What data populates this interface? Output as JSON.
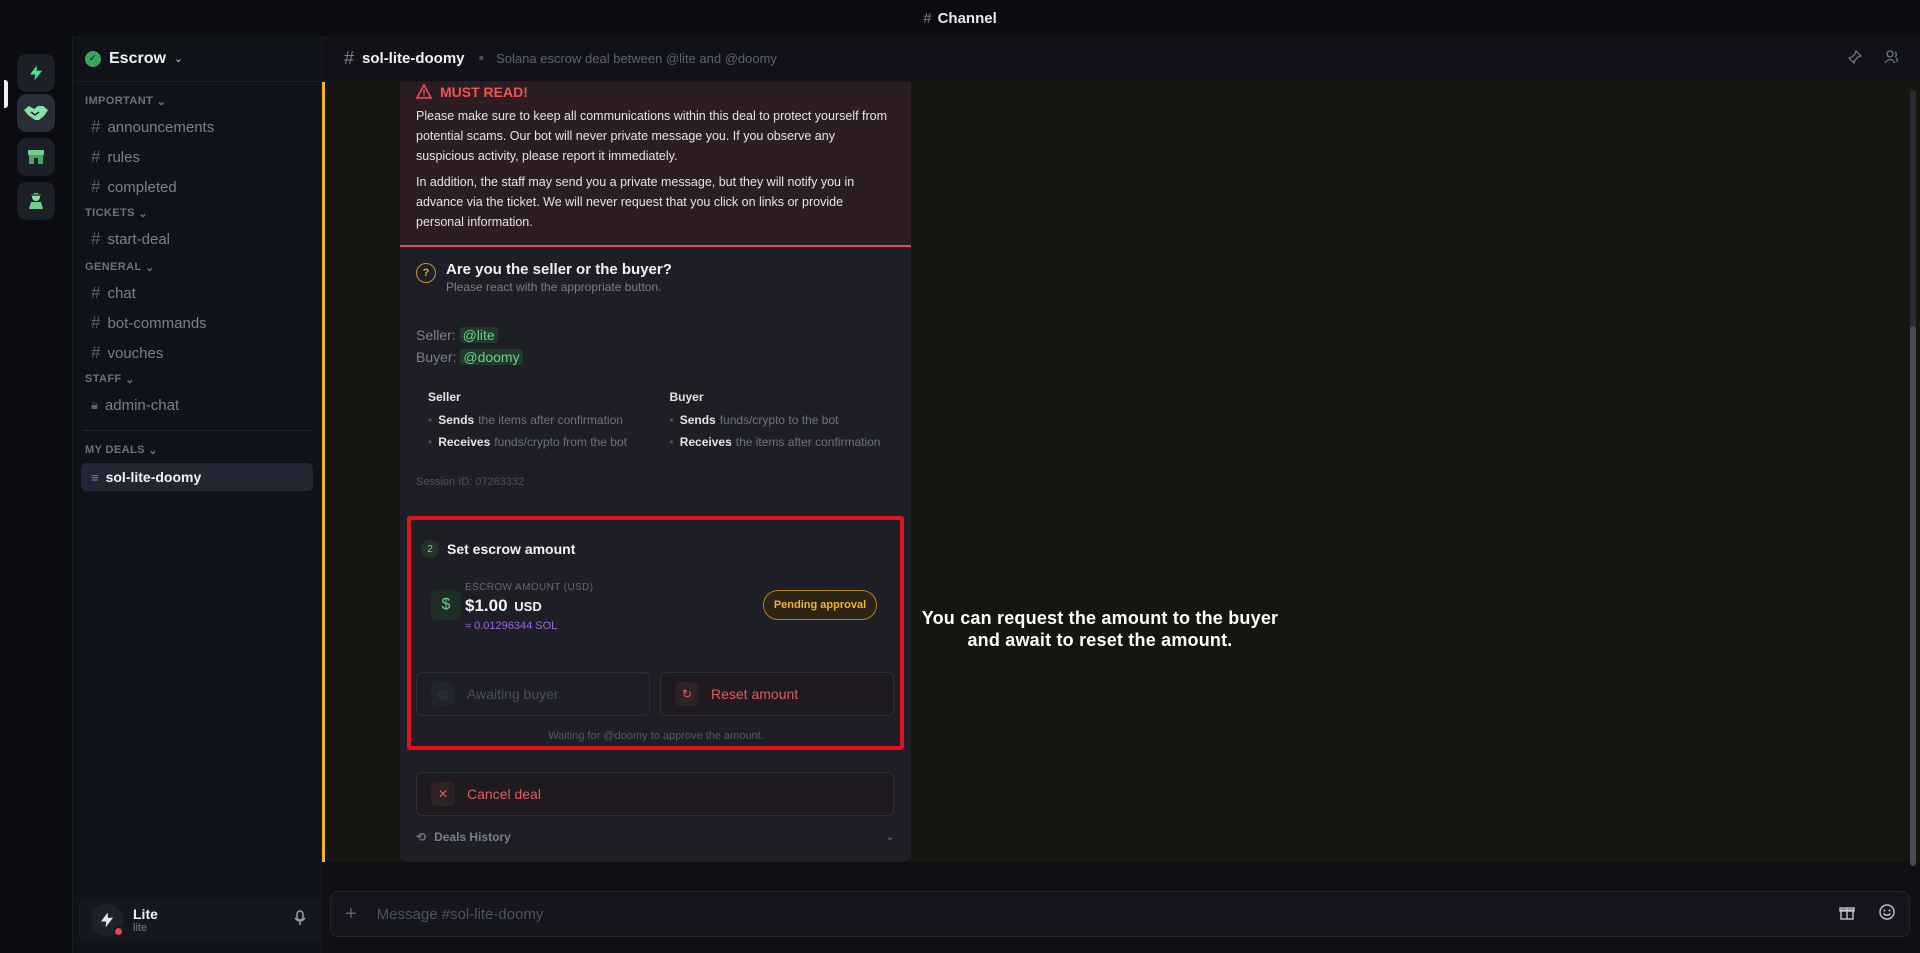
{
  "window": {
    "title": "Channel"
  },
  "guild": {
    "name": "Escrow"
  },
  "sidebar": {
    "categories": [
      {
        "label": "IMPORTANT",
        "channels": [
          "announcements",
          "rules",
          "completed"
        ]
      },
      {
        "label": "TICKETS",
        "channels": [
          "start-deal"
        ]
      },
      {
        "label": "GENERAL",
        "channels": [
          "chat",
          "bot-commands",
          "vouches"
        ]
      },
      {
        "label": "STAFF",
        "channels": [
          "admin-chat"
        ]
      }
    ],
    "my_deals_label": "MY DEALS",
    "active_deal": "sol-lite-doomy"
  },
  "user": {
    "name": "Lite",
    "tag": "lite"
  },
  "channel": {
    "name": "sol-lite-doomy",
    "topic": "Solana escrow deal between @lite and @doomy"
  },
  "embed": {
    "warning_title": "MUST READ!",
    "warning_p1": "Please make sure to keep all communications within this deal to protect yourself from potential scams. Our bot will never private message you. If you observe any suspicious activity, please report it immediately.",
    "warning_p2": "In addition, the staff may send you a private message, but they will notify you in advance via the ticket. We will never request that you click on links or provide personal information.",
    "question_title": "Are you the seller or the buyer?",
    "question_sub": "Please react with the appropriate button.",
    "seller_label": "Seller:",
    "seller_mention": "@lite",
    "buyer_label": "Buyer:",
    "buyer_mention": "@doomy",
    "seller_col": {
      "title": "Seller",
      "item1_bold": "Sends",
      "item1_rest": "the items after confirmation",
      "item2_bold": "Receives",
      "item2_rest": "funds/crypto from the bot"
    },
    "buyer_col": {
      "title": "Buyer",
      "item1_bold": "Sends",
      "item1_rest": "funds/crypto to the bot",
      "item2_bold": "Receives",
      "item2_rest": "the items after confirmation"
    },
    "session": "Session ID: 07263332",
    "step_num": "2",
    "step_title": "Set escrow amount",
    "amount_label": "ESCROW AMOUNT (USD)",
    "amount_value": "$1.00",
    "amount_currency": "USD",
    "amount_sol": "≈ 0.01296344 SOL",
    "pending": "Pending approval",
    "await_btn": "Awaiting buyer",
    "reset_btn": "Reset amount",
    "wait_text": "Waiting for @doomy to approve the amount.",
    "cancel_btn": "Cancel deal",
    "history": "Deals History"
  },
  "note": "You can request the amount to the buyer and await to reset the amount.",
  "composer": {
    "placeholder": "Message #sol-lite-doomy"
  },
  "colors": {
    "accent_warning": "#f0b232",
    "danger": "#e05c5c",
    "highlight_box": "#e3131d",
    "sol": "#a064e6"
  }
}
